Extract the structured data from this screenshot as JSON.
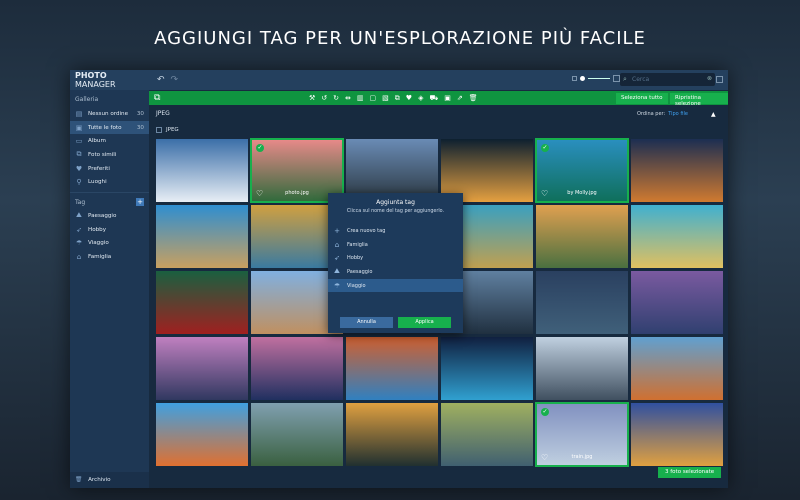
{
  "headline": "AGGIUNGI TAG PER UN'ESPLORAZIONE PIÙ FACILE",
  "app": {
    "brand_bold": "PHOTO",
    "brand_rest": " MANAGER",
    "search_placeholder": "Cerca"
  },
  "sidebar": {
    "gallery_label": "Galleria",
    "items": [
      {
        "label": "Nessun ordine",
        "count": "30",
        "icon": "unsorted-icon",
        "glyph": "▤"
      },
      {
        "label": "Tutte le foto",
        "count": "30",
        "icon": "photos-icon",
        "glyph": "▣"
      },
      {
        "label": "Album",
        "count": "",
        "icon": "album-icon",
        "glyph": "▭"
      },
      {
        "label": "Foto simili",
        "count": "",
        "icon": "similar-icon",
        "glyph": "⧉"
      },
      {
        "label": "Preferiti",
        "count": "",
        "icon": "heart-icon",
        "glyph": "♥"
      },
      {
        "label": "Luoghi",
        "count": "",
        "icon": "location-icon",
        "glyph": "⚲"
      }
    ],
    "tag_label": "Tag",
    "tags": [
      {
        "label": "Paesaggio",
        "icon": "landscape-icon",
        "glyph": "⛰"
      },
      {
        "label": "Hobby",
        "icon": "rocket-icon",
        "glyph": "➶"
      },
      {
        "label": "Viaggio",
        "icon": "palm-icon",
        "glyph": "☂"
      },
      {
        "label": "Famiglia",
        "icon": "home-icon",
        "glyph": "⌂"
      }
    ],
    "archive": "Archivio"
  },
  "toolbar": {
    "select_all": "Seleziona tutto",
    "reset_selection": "Ripristina selezione"
  },
  "main": {
    "group_title": "JPEG",
    "group_checkbox": "JPEG",
    "sort_label": "Ordina per:",
    "sort_value": "Tipo file",
    "status": "3 foto selezionate"
  },
  "photos": [
    {
      "c": [
        "#3b6fa8",
        "#e8eef5"
      ]
    },
    {
      "c": [
        "#e98a8a",
        "#2f6a3b"
      ],
      "sel": true,
      "name": "photo.jpg"
    },
    {
      "c": [
        "#6a8bb5",
        "#2a3740"
      ]
    },
    {
      "c": [
        "#0d2030",
        "#e5a040"
      ]
    },
    {
      "c": [
        "#2a8fc0",
        "#0f6f5a"
      ],
      "sel": true,
      "name": "by Molly.jpg"
    },
    {
      "c": [
        "#1c2e52",
        "#d07a30"
      ]
    },
    {
      "c": [
        "#2f8ed0",
        "#c8a060"
      ]
    },
    {
      "c": [
        "#d0a040",
        "#3a7aa0"
      ]
    },
    {
      "c": [
        "#1a2a40",
        "#1a2a40"
      ]
    },
    {
      "c": [
        "#3aa0c0",
        "#c0a050"
      ]
    },
    {
      "c": [
        "#e0a050",
        "#4a7040"
      ]
    },
    {
      "c": [
        "#40b0d0",
        "#e0c060"
      ]
    },
    {
      "c": [
        "#1a6040",
        "#a02020"
      ]
    },
    {
      "c": [
        "#80b0e0",
        "#c09060"
      ]
    },
    {
      "c": [
        "#1a2a40",
        "#1a2a40"
      ]
    },
    {
      "c": [
        "#6080a0",
        "#203040"
      ]
    },
    {
      "c": [
        "#2a4060",
        "#40607a"
      ]
    },
    {
      "c": [
        "#7a5aa0",
        "#304070"
      ]
    },
    {
      "c": [
        "#c080c0",
        "#303860"
      ]
    },
    {
      "c": [
        "#c070a0",
        "#203060"
      ]
    },
    {
      "c": [
        "#d06030",
        "#3080c0"
      ]
    },
    {
      "c": [
        "#102040",
        "#30a0d0"
      ]
    },
    {
      "c": [
        "#c0d0e0",
        "#405060"
      ]
    },
    {
      "c": [
        "#60a0d0",
        "#d07030"
      ]
    },
    {
      "c": [
        "#40a0e0",
        "#e07030"
      ]
    },
    {
      "c": [
        "#80a0b0",
        "#3a6040"
      ]
    },
    {
      "c": [
        "#e0a040",
        "#203030"
      ]
    },
    {
      "c": [
        "#a0b060",
        "#406070"
      ]
    },
    {
      "c": [
        "#8090c0",
        "#c0d0e0"
      ],
      "sel": true,
      "name": "train.jpg"
    },
    {
      "c": [
        "#3050a0",
        "#e0a040"
      ]
    }
  ],
  "dialog": {
    "title": "Aggiunta tag",
    "subtitle": "Clicca sul nome del tag per aggiungerlo.",
    "items": [
      {
        "label": "Crea nuovo tag",
        "glyph": "+",
        "icon": "plus-icon"
      },
      {
        "label": "Famiglia",
        "glyph": "⌂",
        "icon": "home-icon"
      },
      {
        "label": "Hobby",
        "glyph": "➶",
        "icon": "rocket-icon"
      },
      {
        "label": "Paesaggio",
        "glyph": "⛰",
        "icon": "landscape-icon"
      },
      {
        "label": "Viaggio",
        "glyph": "☂",
        "icon": "palm-icon",
        "active": true
      }
    ],
    "cancel": "Annulla",
    "apply": "Applica"
  },
  "colors": {
    "accent": "#17b04d",
    "toolbar": "#0f9440",
    "sidebar": "#1e3754",
    "cancel": "#3a6a9e"
  }
}
